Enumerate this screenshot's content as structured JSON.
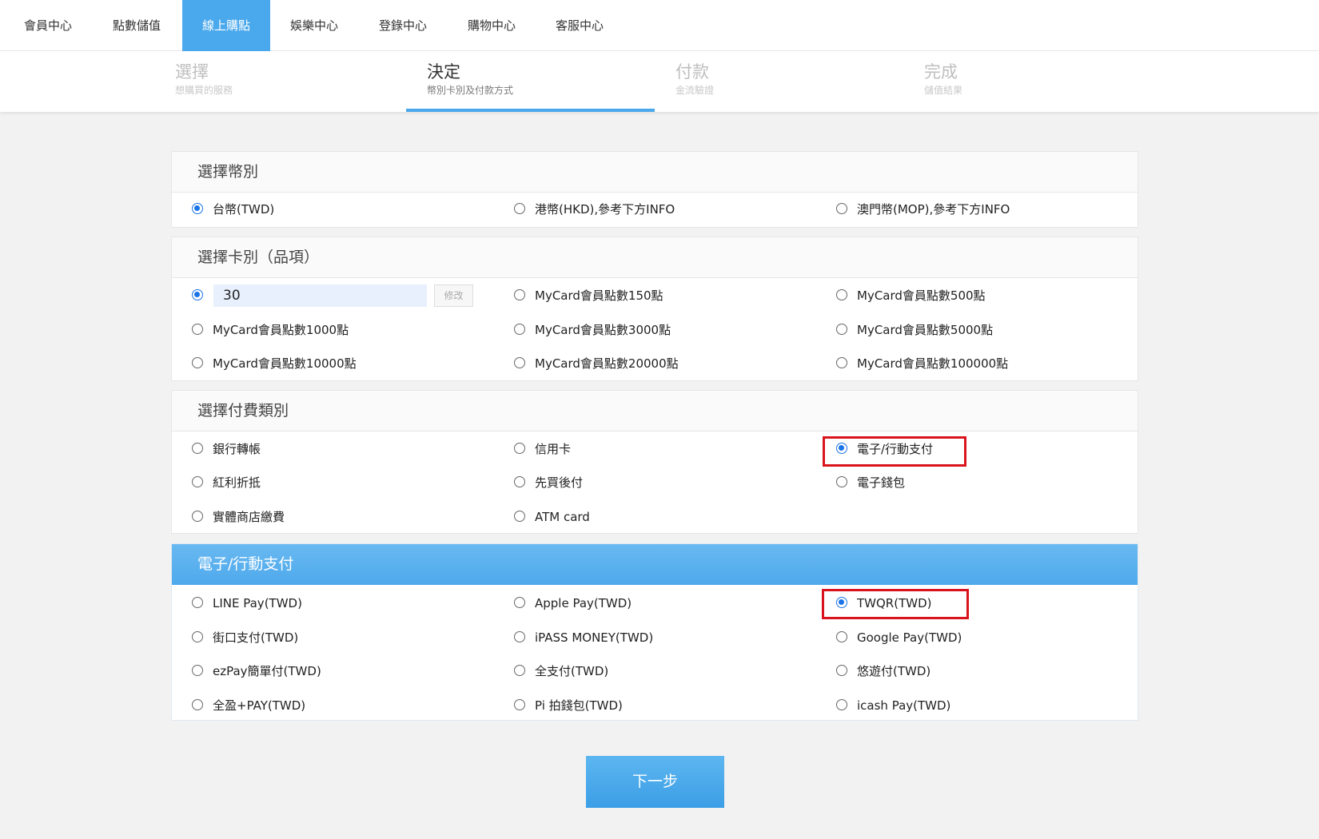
{
  "nav": {
    "items": [
      "會員中心",
      "點數儲值",
      "線上購點",
      "娛樂中心",
      "登錄中心",
      "購物中心",
      "客服中心"
    ],
    "active_index": 2
  },
  "steps": [
    {
      "title": "選擇",
      "sub": "想購買的服務"
    },
    {
      "title": "決定",
      "sub": "幣別卡別及付款方式"
    },
    {
      "title": "付款",
      "sub": "金流驗證"
    },
    {
      "title": "完成",
      "sub": "儲值結果"
    }
  ],
  "current_step": 1,
  "currency": {
    "title": "選擇幣別",
    "options": [
      "台幣(TWD)",
      "港幣(HKD),參考下方INFO",
      "澳門幣(MOP),參考下方INFO"
    ],
    "selected": 0
  },
  "card": {
    "title": "選擇卡別（品項）",
    "custom_amount": "30",
    "modify_label": "修改",
    "options": [
      "MyCard會員點數150點",
      "MyCard會員點數500點",
      "MyCard會員點數1000點",
      "MyCard會員點數3000點",
      "MyCard會員點數5000點",
      "MyCard會員點數10000點",
      "MyCard會員點數20000點",
      "MyCard會員點數100000點"
    ]
  },
  "payment_type": {
    "title": "選擇付費類別",
    "options": [
      "銀行轉帳",
      "信用卡",
      "電子/行動支付",
      "紅利折抵",
      "先買後付",
      "電子錢包",
      "實體商店繳費",
      "ATM card"
    ],
    "selected": 2
  },
  "mobile_pay": {
    "title": "電子/行動支付",
    "options": [
      "LINE Pay(TWD)",
      "Apple Pay(TWD)",
      "TWQR(TWD)",
      "街口支付(TWD)",
      "iPASS MONEY(TWD)",
      "Google Pay(TWD)",
      "ezPay簡單付(TWD)",
      "全支付(TWD)",
      "悠遊付(TWD)",
      "全盈+PAY(TWD)",
      "Pi 拍錢包(TWD)",
      "icash Pay(TWD)"
    ],
    "selected": 2
  },
  "colors": {
    "accent": "#4aa8ec",
    "highlight": "#d9141c",
    "radio_checked": "#1a73e8"
  },
  "next_label": "下一步"
}
